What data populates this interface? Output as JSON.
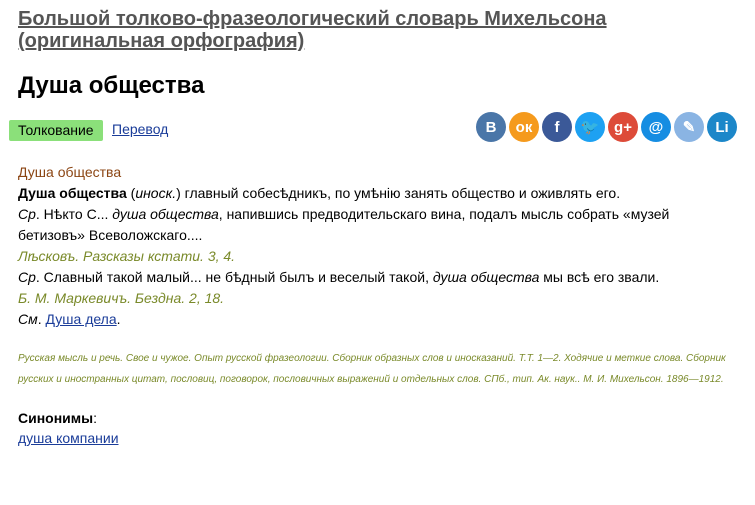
{
  "dictionary": {
    "title": "Большой толково-фразеологический словарь Михельсона (оригинальная орфография)"
  },
  "word": "Душа общества",
  "tabs": {
    "active": "Толкование",
    "other": "Перевод"
  },
  "share": [
    {
      "name": "vk-icon",
      "glyph": "B",
      "color": "#4a76a8"
    },
    {
      "name": "ok-icon",
      "glyph": "ок",
      "color": "#f59a1d"
    },
    {
      "name": "facebook-icon",
      "glyph": "f",
      "color": "#3b5998"
    },
    {
      "name": "twitter-icon",
      "glyph": "🐦",
      "color": "#1da1f2"
    },
    {
      "name": "googleplus-icon",
      "glyph": "g+",
      "color": "#dd4b39"
    },
    {
      "name": "mail-icon",
      "glyph": "@",
      "color": "#168de2"
    },
    {
      "name": "livejournal-icon",
      "glyph": "✎",
      "color": "#8ab4e3"
    },
    {
      "name": "linkedin-icon",
      "glyph": "Li",
      "color": "#1c87c9"
    }
  ],
  "entry": {
    "heading": "Душа общества",
    "def_term": "Душа общества",
    "def_note": "иноск.",
    "def_text": ") главный собесѣдникъ, по умѣнію занять общество и оживлять его.",
    "ex1_see": "Ср",
    "ex1_a": ". Нѣкто С... ",
    "ex1_em": "душа общества",
    "ex1_b": ", напившись предводительскаго вина, подалъ мысль собрать «музей бетизовъ» Всеволожскаго....",
    "src1": "Лѣсковъ. Разсказы кстати. 3, 4.",
    "ex2_see": "Ср",
    "ex2_a": ". Славный такой малый... не бѣдный былъ и веселый такой, ",
    "ex2_em": "душа общества",
    "ex2_b": " мы всѣ его звали.",
    "src2": "Б. М. Маркевичъ. Бездна. 2, 18.",
    "see_label": "См",
    "see_link": "Душа дела"
  },
  "bibliography": "Русская мысль и речь. Свое и чужое. Опыт русской фразеологии. Сборник образных слов и иносказаний. Т.Т. 1—2. Ходячие и меткие слова. Сборник русских и иностранных цитат, пословиц, поговорок, пословичных выражений и отдельных слов. СПб., тип. Ак. наук.. М. И. Михельсон. 1896—1912.",
  "synonyms": {
    "label": "Синонимы",
    "items": [
      "душа компании"
    ]
  }
}
